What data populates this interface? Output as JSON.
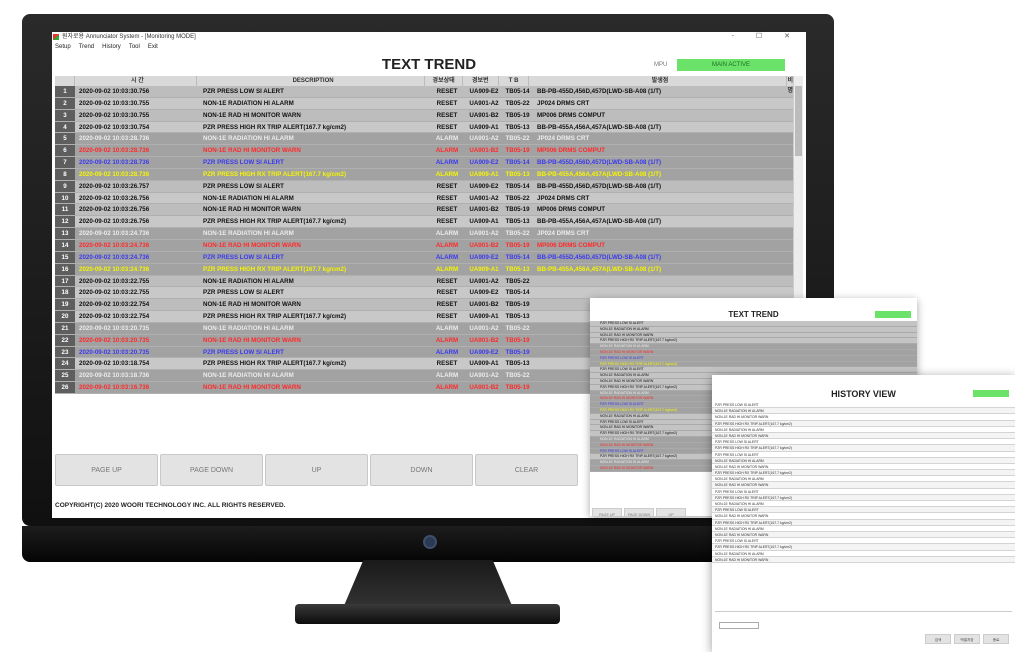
{
  "window": {
    "title": "원자로용 Annunciator System - [Monitoring MODE]",
    "controls": "-  ☐  ✕"
  },
  "menu": [
    "Setup",
    "Trend",
    "History",
    "Tool",
    "Exit"
  ],
  "app_title": "TEXT TREND",
  "mpu": {
    "label": "MPU",
    "status": "MAIN ACTIVE"
  },
  "colors": {
    "alarm_red": "#ff2a2a",
    "alarm_blue": "#3a3af0",
    "alarm_yellow": "#f5f500",
    "alarm_gray": "#ececec",
    "active_green": "#6be36b"
  },
  "columns": [
    "",
    "시    간",
    "DESCRIPTION",
    "경보상태",
    "경보번",
    "T B",
    "발생점",
    "비 명"
  ],
  "rows": [
    {
      "n": "1",
      "time": "2020-09-02 10:03:30.756",
      "desc": "PZR PRESS LOW SI ALERT",
      "state": "RESET",
      "code": "UA909-E2",
      "tb": "TB05-14",
      "loc": "BB-PB-455D,456D,457D(LWD-SB-A08 (1/T)",
      "color": "normal"
    },
    {
      "n": "2",
      "time": "2020-09-02 10:03:30.755",
      "desc": "NON-1E RADIATION HI ALARM",
      "state": "RESET",
      "code": "UA901-A2",
      "tb": "TB05-22",
      "loc": "JP024 DRMS CRT",
      "color": "normal"
    },
    {
      "n": "3",
      "time": "2020-09-02 10:03:30.755",
      "desc": "NON-1E RAD HI MONITOR WARN",
      "state": "RESET",
      "code": "UA901-B2",
      "tb": "TB05-19",
      "loc": "MP006 DRMS COMPUT",
      "color": "normal"
    },
    {
      "n": "4",
      "time": "2020-09-02 10:03:30.754",
      "desc": "PZR PRESS HIGH RX TRIP ALERT(167.7 kg/cm2)",
      "state": "RESET",
      "code": "UA909-A1",
      "tb": "TB05-13",
      "loc": "BB-PB-455A,456A,457A(LWD-SB-A08 (1/T)",
      "color": "normal"
    },
    {
      "n": "5",
      "time": "2020-09-02 10:03:28.736",
      "desc": "NON-1E RADIATION HI ALARM",
      "state": "ALARM",
      "code": "UA901-A2",
      "tb": "TB05-22",
      "loc": "JP024 DRMS CRT",
      "color": "gray"
    },
    {
      "n": "6",
      "time": "2020-09-02 10:03:28.736",
      "desc": "NON-1E RAD HI MONITOR WARN",
      "state": "ALARM",
      "code": "UA901-B2",
      "tb": "TB05-19",
      "loc": "MP006 DRMS COMPUT",
      "color": "red"
    },
    {
      "n": "7",
      "time": "2020-09-02 10:03:28.736",
      "desc": "PZR PRESS LOW SI ALERT",
      "state": "ALARM",
      "code": "UA909-E2",
      "tb": "TB05-14",
      "loc": "BB-PB-455D,456D,457D(LWD-SB-A08 (1/T)",
      "color": "blue"
    },
    {
      "n": "8",
      "time": "2020-09-02 10:03:28.736",
      "desc": "PZR PRESS HIGH RX TRIP ALERT(167.7 kg/cm2)",
      "state": "ALARM",
      "code": "UA909-A1",
      "tb": "TB05-13",
      "loc": "BB-PB-455A,456A,457A(LWD-SB-A08 (1/T)",
      "color": "yellow"
    },
    {
      "n": "9",
      "time": "2020-09-02 10:03:26.757",
      "desc": "PZR PRESS LOW SI ALERT",
      "state": "RESET",
      "code": "UA909-E2",
      "tb": "TB05-14",
      "loc": "BB-PB-455D,456D,457D(LWD-SB-A08 (1/T)",
      "color": "normal"
    },
    {
      "n": "10",
      "time": "2020-09-02 10:03:26.756",
      "desc": "NON-1E RADIATION HI ALARM",
      "state": "RESET",
      "code": "UA901-A2",
      "tb": "TB05-22",
      "loc": "JP024 DRMS CRT",
      "color": "normal"
    },
    {
      "n": "11",
      "time": "2020-09-02 10:03:26.756",
      "desc": "NON-1E RAD HI MONITOR WARN",
      "state": "RESET",
      "code": "UA901-B2",
      "tb": "TB05-19",
      "loc": "MP006 DRMS COMPUT",
      "color": "normal"
    },
    {
      "n": "12",
      "time": "2020-09-02 10:03:26.756",
      "desc": "PZR PRESS HIGH RX TRIP ALERT(167.7 kg/cm2)",
      "state": "RESET",
      "code": "UA909-A1",
      "tb": "TB05-13",
      "loc": "BB-PB-455A,456A,457A(LWD-SB-A08 (1/T)",
      "color": "normal"
    },
    {
      "n": "13",
      "time": "2020-09-02 10:03:24.736",
      "desc": "NON-1E RADIATION HI ALARM",
      "state": "ALARM",
      "code": "UA901-A2",
      "tb": "TB05-22",
      "loc": "JP024 DRMS CRT",
      "color": "gray"
    },
    {
      "n": "14",
      "time": "2020-09-02 10:03:24.736",
      "desc": "NON-1E RAD HI MONITOR WARN",
      "state": "ALARM",
      "code": "UA901-B2",
      "tb": "TB05-19",
      "loc": "MP006 DRMS COMPUT",
      "color": "red"
    },
    {
      "n": "15",
      "time": "2020-09-02 10:03:24.736",
      "desc": "PZR PRESS LOW SI ALERT",
      "state": "ALARM",
      "code": "UA909-E2",
      "tb": "TB05-14",
      "loc": "BB-PB-455D,456D,457D(LWD-SB-A08 (1/T)",
      "color": "blue"
    },
    {
      "n": "16",
      "time": "2020-09-02 10:03:24.736",
      "desc": "PZR PRESS HIGH RX TRIP ALERT(167.7 kg/cm2)",
      "state": "ALARM",
      "code": "UA909-A1",
      "tb": "TB05-13",
      "loc": "BB-PB-455A,456A,457A(LWD-SB-A08 (1/T)",
      "color": "yellow"
    },
    {
      "n": "17",
      "time": "2020-09-02 10:03:22.755",
      "desc": "NON-1E RADIATION HI ALARM",
      "state": "RESET",
      "code": "UA901-A2",
      "tb": "TB05-22",
      "loc": "",
      "color": "normal"
    },
    {
      "n": "18",
      "time": "2020-09-02 10:03:22.755",
      "desc": "PZR PRESS LOW SI ALERT",
      "state": "RESET",
      "code": "UA909-E2",
      "tb": "TB05-14",
      "loc": "",
      "color": "normal"
    },
    {
      "n": "19",
      "time": "2020-09-02 10:03:22.754",
      "desc": "NON-1E RAD HI MONITOR WARN",
      "state": "RESET",
      "code": "UA901-B2",
      "tb": "TB05-19",
      "loc": "",
      "color": "normal"
    },
    {
      "n": "20",
      "time": "2020-09-02 10:03:22.754",
      "desc": "PZR PRESS HIGH RX TRIP ALERT(167.7 kg/cm2)",
      "state": "RESET",
      "code": "UA909-A1",
      "tb": "TB05-13",
      "loc": "",
      "color": "normal"
    },
    {
      "n": "21",
      "time": "2020-09-02 10:03:20.735",
      "desc": "NON-1E RADIATION HI ALARM",
      "state": "ALARM",
      "code": "UA901-A2",
      "tb": "TB05-22",
      "loc": "",
      "color": "gray"
    },
    {
      "n": "22",
      "time": "2020-09-02 10:03:20.735",
      "desc": "NON-1E RAD HI MONITOR WARN",
      "state": "ALARM",
      "code": "UA901-B2",
      "tb": "TB05-19",
      "loc": "",
      "color": "red"
    },
    {
      "n": "23",
      "time": "2020-09-02 10:03:20.735",
      "desc": "PZR PRESS LOW SI ALERT",
      "state": "ALARM",
      "code": "UA909-E2",
      "tb": "TB05-19",
      "loc": "",
      "color": "blue"
    },
    {
      "n": "24",
      "time": "2020-09-02 10:03:18.754",
      "desc": "PZR PRESS HIGH RX TRIP ALERT(167.7 kg/cm2)",
      "state": "RESET",
      "code": "UA909-A1",
      "tb": "TB05-13",
      "loc": "",
      "color": "normal"
    },
    {
      "n": "25",
      "time": "2020-09-02 10:03:18.736",
      "desc": "NON-1E RADIATION HI ALARM",
      "state": "ALARM",
      "code": "UA901-A2",
      "tb": "TB05-22",
      "loc": "",
      "color": "gray"
    },
    {
      "n": "26",
      "time": "2020-09-02 10:03:16.736",
      "desc": "NON-1E RAD HI MONITOR WARN",
      "state": "ALARM",
      "code": "UA901-B2",
      "tb": "TB05-19",
      "loc": "",
      "color": "red"
    }
  ],
  "buttons": [
    "PAGE UP",
    "PAGE DOWN",
    "UP",
    "DOWN",
    "CLEAR"
  ],
  "copyright": "COPYRIGHT(C) 2020 WOORI TECHNOLOGY INC. ALL RIGHTS RESERVED.",
  "panel1": {
    "title": "TEXT TREND",
    "buttons": [
      "PAGE UP",
      "PAGE DOWN",
      "UP"
    ]
  },
  "panel2": {
    "title": "HISTORY VIEW",
    "buttons": [
      "검색",
      "엑셀저장",
      "종료"
    ]
  }
}
